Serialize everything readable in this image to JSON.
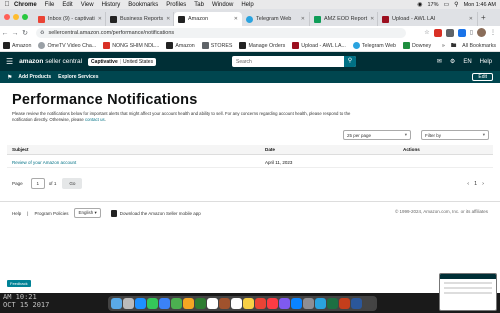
{
  "menubar": {
    "items": [
      "Chrome",
      "File",
      "Edit",
      "View",
      "History",
      "Bookmarks",
      "Profiles",
      "Tab",
      "Window",
      "Help"
    ],
    "battery": "17%",
    "clock": "Mon 1:46 AM"
  },
  "tabs": [
    {
      "label": "Inbox (9) - captivati",
      "color": "#ea4335"
    },
    {
      "label": "Business Reports",
      "color": "#222222"
    },
    {
      "label": "Amazon",
      "color": "#222222"
    },
    {
      "label": "Telegram Web",
      "color": "#2aa3df"
    },
    {
      "label": "AMZ EOD Report",
      "color": "#0f9d58"
    },
    {
      "label": "Upload - AWL LAI",
      "color": "#9c0f1f"
    }
  ],
  "address": {
    "url": "sellercentral.amazon.com/performance/notifications"
  },
  "bookmarks": [
    {
      "label": "Amazon",
      "color": "#222222"
    },
    {
      "label": "OmeTV Video Cha...",
      "color": "#9aa0a6"
    },
    {
      "label": "NONG SHIM NDL...",
      "color": "#d93025"
    },
    {
      "label": "Amazon",
      "color": "#222222"
    },
    {
      "label": "STORES",
      "color": "#5f6368"
    },
    {
      "label": "Manage Orders",
      "color": "#222222"
    },
    {
      "label": "Upload - AWL LA...",
      "color": "#9c0f1f"
    },
    {
      "label": "Telegram Web",
      "color": "#2aa3df"
    },
    {
      "label": "Downey",
      "color": "#1e8e3e"
    }
  ],
  "bookmarks_right": "All Bookmarks",
  "seller": {
    "logo": "amazon",
    "logo_suffix": "seller central",
    "marketplace_store": "Captivative",
    "marketplace_region": "United States",
    "search_placeholder": "Search",
    "language": "EN",
    "help": "Help",
    "nav": [
      "Add Products",
      "Explore Services"
    ],
    "edit": "Edit"
  },
  "main": {
    "title": "Performance Notifications",
    "desc_text": "Please review the notifications below for important alerts that might affect your account health and ability to sell. For any concerns regarding account health, please respond to the notification directly. Otherwise, please",
    "desc_link": "contact us",
    "per_page": "25 per page",
    "filter": "Filter by",
    "columns": {
      "subject": "Subject",
      "date": "Date",
      "actions": "Actions"
    },
    "rows": [
      {
        "subject": "Review of your Amazon account",
        "date": "April 11, 2023"
      }
    ],
    "pager": {
      "page_label": "Page",
      "page_value": "1",
      "of_label": "of 1",
      "go": "Go",
      "current": "1"
    }
  },
  "footer": {
    "help": "Help",
    "policies": "Program Policies",
    "language": "English",
    "app_text": "Download the Amazon Seller mobile app",
    "copyright": "© 1999-2024, Amazon.com, Inc. or its affiliates"
  },
  "feedback": "Feedback",
  "desktop_stamp": "AM 10:21\nOCT 15 2017"
}
